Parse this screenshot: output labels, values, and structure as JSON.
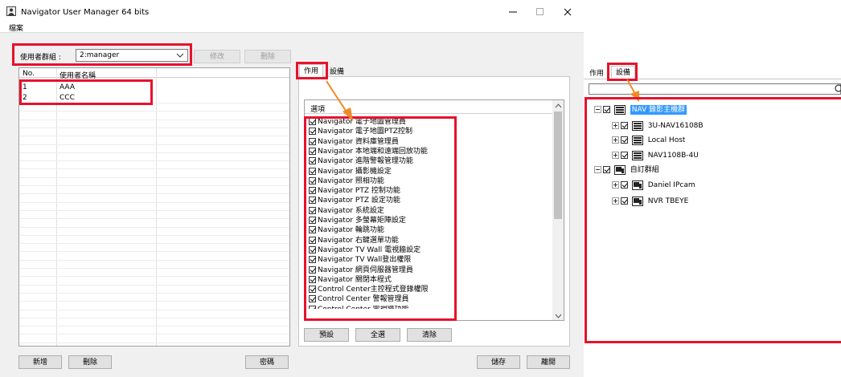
{
  "window": {
    "title": "Navigator User Manager 64 bits",
    "menu": [
      "檔案"
    ]
  },
  "user_group": {
    "label": "使用者群組 :",
    "selected": "2:manager",
    "modify_button": "修改",
    "delete_button": "刪除"
  },
  "users_table": {
    "columns": [
      "No.",
      "使用者名稱"
    ],
    "rows": [
      {
        "no": "1",
        "name": "AAA"
      },
      {
        "no": "2",
        "name": "CCC"
      }
    ]
  },
  "bottom_buttons": {
    "add": "新增",
    "delete": "刪除",
    "password": "密碼",
    "save": "儲存",
    "leave": "離開"
  },
  "tabs": {
    "action": "作用",
    "device": "設備"
  },
  "options": {
    "header": "選項",
    "items": [
      "Navigator 電子地圖管理員",
      "Navigator 電子地圖PTZ控制",
      "Navigator 資料庫管理員",
      "Navigator 本地端和遠端回放功能",
      "Navigator 進階警報管理功能",
      "Navigator 攝影機設定",
      "Navigator 照相功能",
      "Navigator PTZ 控制功能",
      "Navigator PTZ 設定功能",
      "Navigator 系統設定",
      "Navigator 多螢幕矩陣設定",
      "Navigator 輪跳功能",
      "Navigator 右鍵選單功能",
      "Navigator TV Wall 電視牆設定",
      "Navigator TV Wall登出權限",
      "Navigator 網頁伺服器管理員",
      "Navigator 關閉本程式",
      "Control Center主控程式登錄權限",
      "Control Center 警報管理員",
      "Control Center 電視牆功能"
    ],
    "default_button": "預設",
    "select_all_button": "全選",
    "clear_button": "清除"
  },
  "device_tree": {
    "root": "NAV 錄影主機群",
    "hosts": [
      "3U-NAV16108B",
      "Local Host",
      "NAV1108B-4U"
    ],
    "custom_group": "自訂群組",
    "cams": [
      "Daniel IPcam",
      "NVR TBEYE"
    ]
  },
  "colors": {
    "highlight": "#e8112d",
    "arrow": "#f08a24",
    "selection": "#3399ff"
  }
}
